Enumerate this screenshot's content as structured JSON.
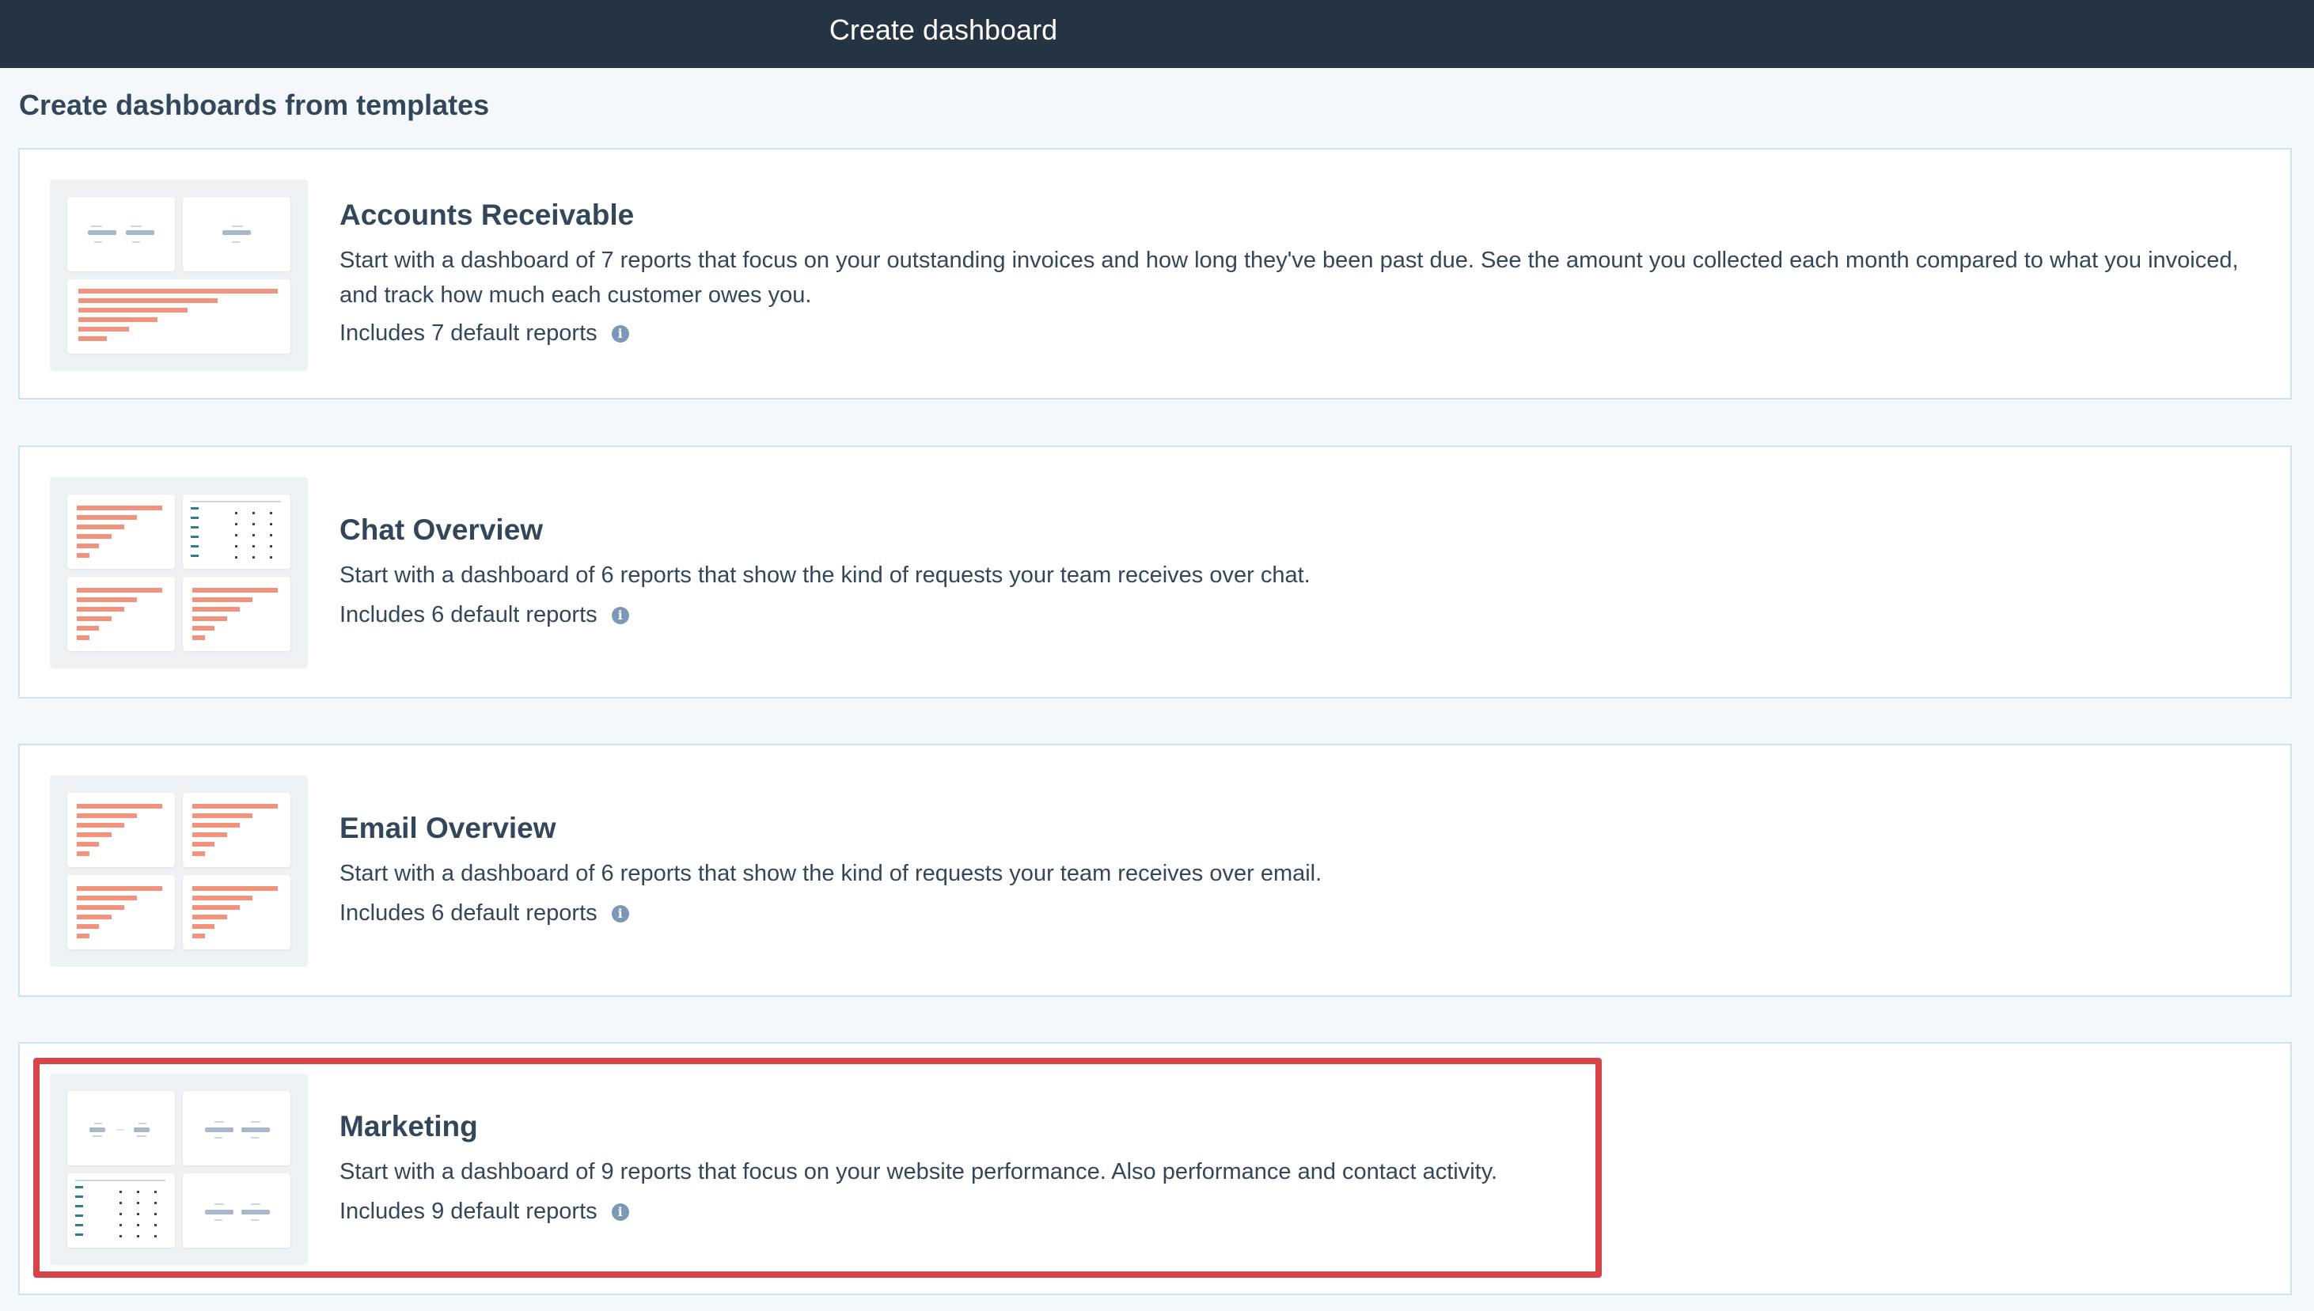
{
  "header": {
    "title": "Create dashboard"
  },
  "section": {
    "title": "Create dashboards from templates"
  },
  "templates": [
    {
      "title": "Accounts Receivable",
      "description": "Start with a dashboard of 7 reports that focus on your outstanding invoices and how long they've been past due. See the amount you collected each month compared to what you invoiced, and track how much each customer owes you.",
      "meta": "Includes 7 default reports"
    },
    {
      "title": "Chat Overview",
      "description": "Start with a dashboard of 6 reports that show the kind of requests your team receives over chat.",
      "meta": "Includes 6 default reports"
    },
    {
      "title": "Email Overview",
      "description": "Start with a dashboard of 6 reports that show the kind of requests your team receives over email.",
      "meta": "Includes 6 default reports"
    },
    {
      "title": "Marketing",
      "description": "Start with a dashboard of 9 reports that focus on your website performance. Also performance and contact activity.",
      "meta": "Includes 9 default reports"
    }
  ],
  "icons": {
    "info": "info-icon"
  },
  "colors": {
    "header_bg": "#253342",
    "accent_bar": "#f2937e",
    "highlight": "#d9434a"
  }
}
